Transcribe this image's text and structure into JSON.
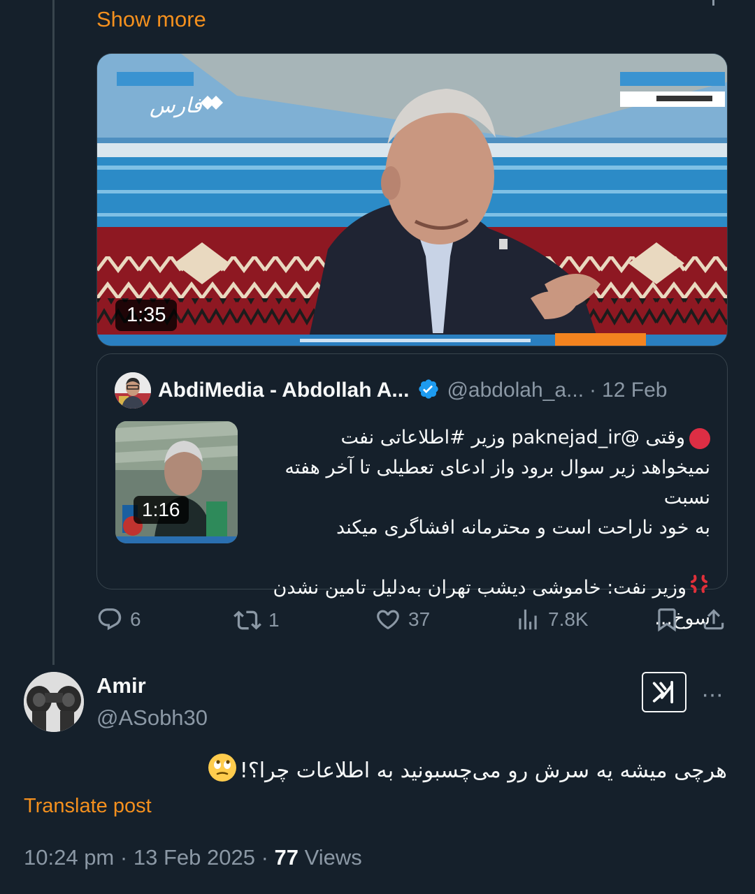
{
  "parent": {
    "show_more": "Show more",
    "video": {
      "duration": "1:35",
      "channel_logo_text": "فارس",
      "colors": {
        "sky": "#3d86b8",
        "carpet": "#8e1822",
        "ticker": "#2a7fc0",
        "ticker_accent": "#f3831f"
      }
    },
    "quote": {
      "name": "AbdiMedia - Abdollah A...",
      "handle": "@abdolah_a...",
      "separator": "·",
      "date": "12 Feb",
      "thumb_duration": "1:16",
      "line1": "وقتی @paknejad_ir وزیر #اطلاعاتی نفت",
      "line2": "نمیخواهد زیر سوال برود واز ادعای تعطیلی تا آخر هفته نسبت",
      "line3": "به خود ناراحت است و محترمانه افشاگری میکند",
      "line4": "وزیر نفت: خاموشی دیشب تهران به‌دلیل تامین نشدن سوخ..."
    },
    "actions": {
      "replies": "6",
      "reposts": "1",
      "likes": "37",
      "views": "7.8K"
    }
  },
  "reply": {
    "name": "Amir",
    "handle": "@ASobh30",
    "more": "···",
    "text": "هرچی میشه یه سرش رو می‌چسبونید به اطلاعات چرا؟!",
    "translate": "Translate post",
    "time": "10:24 pm",
    "dot": "·",
    "date": "13 Feb 2025",
    "views_count": "77",
    "views_label": "Views"
  },
  "colors": {
    "accent": "#f4901e",
    "background": "#15202b",
    "muted": "#8b98a5",
    "verified": "#1d9bf0"
  }
}
